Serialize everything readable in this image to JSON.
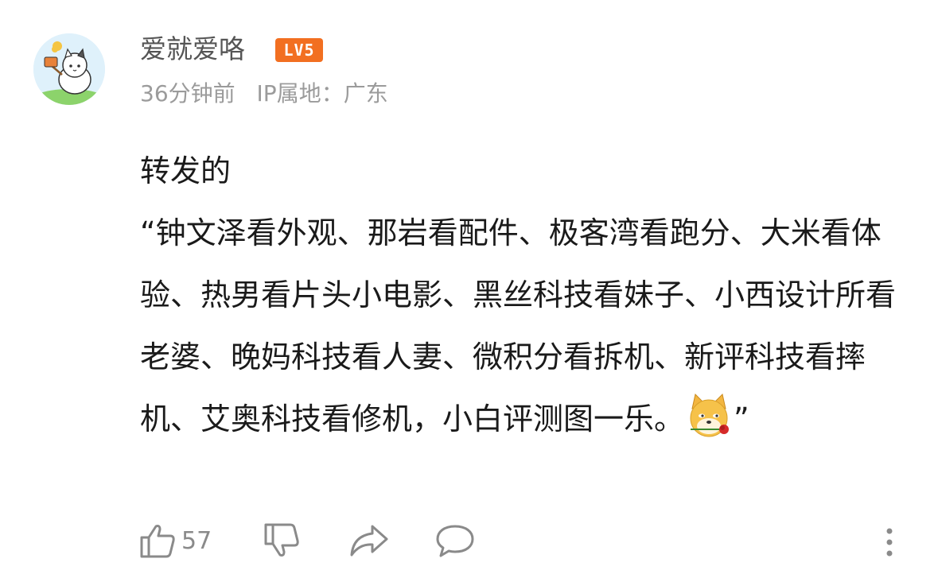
{
  "user": {
    "name": "爱就爱咯",
    "level_badge": "LV5",
    "time": "36分钟前",
    "ip_location": "IP属地：广东"
  },
  "comment": {
    "line1": "转发的",
    "quote_body": "“钟文泽看外观、那岩看配件、极客湾看跑分、大米看体验、热男看片头小电影、黑丝科技看妹子、小西设计所看老婆、晚妈科技看人妻、微积分看拆机、新评科技看摔机、艾奥科技看修机，小白评测图一乐。",
    "quote_end": "”",
    "emoji": "dog-rose-emoji"
  },
  "actions": {
    "like_count": "57",
    "icons": [
      "thumbs-up-icon",
      "thumbs-down-icon",
      "share-icon",
      "comment-icon",
      "more-icon"
    ]
  },
  "colors": {
    "badge": "#f26f21",
    "meta_text": "#9b9b9b",
    "icon_stroke": "#8a8a8a"
  }
}
